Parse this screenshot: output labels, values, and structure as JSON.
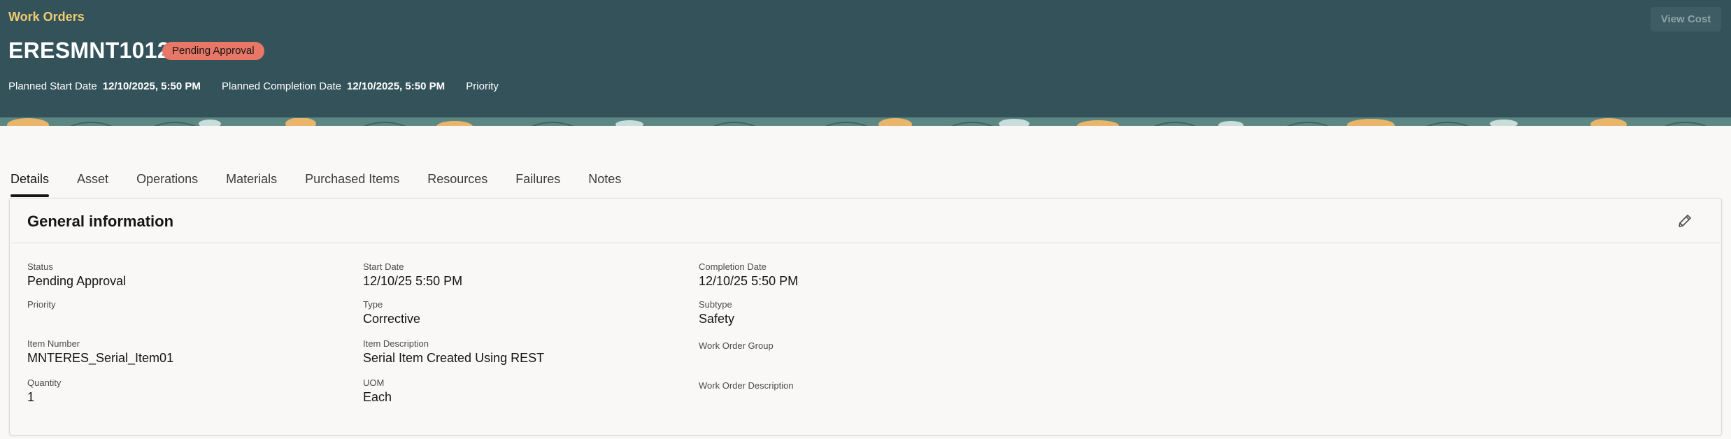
{
  "header": {
    "breadcrumb": "Work Orders",
    "title": "ERESMNT1012",
    "status_badge": "Pending Approval",
    "planned_start_label": "Planned Start Date",
    "planned_start_value": "12/10/2025, 5:50 PM",
    "planned_completion_label": "Planned Completion Date",
    "planned_completion_value": "12/10/2025, 5:50 PM",
    "priority_label": "Priority",
    "view_cost_label": "View Cost"
  },
  "tabs": [
    {
      "label": "Details",
      "active": true
    },
    {
      "label": "Asset"
    },
    {
      "label": "Operations"
    },
    {
      "label": "Materials"
    },
    {
      "label": "Purchased Items"
    },
    {
      "label": "Resources"
    },
    {
      "label": "Failures"
    },
    {
      "label": "Notes"
    }
  ],
  "card": {
    "title": "General information",
    "edit_icon": "pencil-icon",
    "fields": {
      "status": {
        "label": "Status",
        "value": "Pending Approval"
      },
      "start_date": {
        "label": "Start Date",
        "value": "12/10/25 5:50 PM"
      },
      "completion_date": {
        "label": "Completion Date",
        "value": "12/10/25 5:50 PM"
      },
      "priority": {
        "label": "Priority",
        "value": ""
      },
      "type": {
        "label": "Type",
        "value": "Corrective"
      },
      "subtype": {
        "label": "Subtype",
        "value": "Safety"
      },
      "item_number": {
        "label": "Item Number",
        "value": "MNTERES_Serial_Item01"
      },
      "item_description": {
        "label": "Item Description",
        "value": "Serial Item Created Using REST"
      },
      "work_order_group": {
        "label": "Work Order Group",
        "value": ""
      },
      "quantity": {
        "label": "Quantity",
        "value": "1"
      },
      "uom": {
        "label": "UOM",
        "value": "Each"
      },
      "work_order_description": {
        "label": "Work Order Description",
        "value": ""
      }
    }
  },
  "colors": {
    "header_bg": "#33525a",
    "breadcrumb": "#f0cc71",
    "badge_bg": "#e87767",
    "page_bg": "#f9f8f6"
  }
}
